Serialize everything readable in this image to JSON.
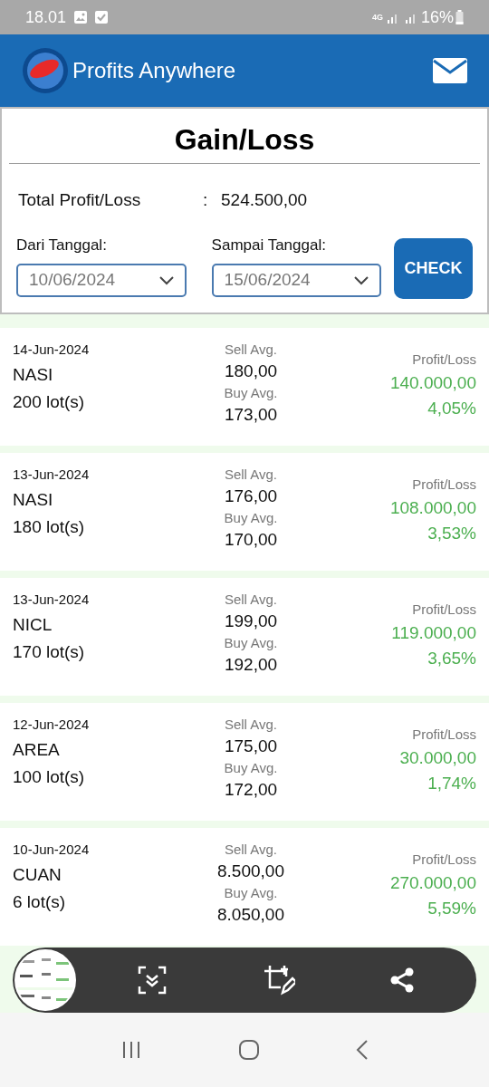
{
  "status_bar": {
    "time": "18.01",
    "network": "4G",
    "battery": "16%"
  },
  "app_bar": {
    "title": "Profits Anywhere"
  },
  "summary": {
    "title": "Gain/Loss",
    "total_label": "Total Profit/Loss",
    "separator": ":",
    "total_value": "524.500,00",
    "from_label": "Dari Tanggal:",
    "from_value": "10/06/2024",
    "to_label": "Sampai Tanggal:",
    "to_value": "15/06/2024",
    "check_button": "CHECK"
  },
  "trades": [
    {
      "date": "14-Jun-2024",
      "code": "NASI",
      "lots": "200 lot(s)",
      "sell_label": "Sell Avg.",
      "sell_avg": "180,00",
      "buy_label": "Buy Avg.",
      "buy_avg": "173,00",
      "pl_label": "Profit/Loss",
      "pl_value": "140.000,00",
      "pl_percent": "4,05%"
    },
    {
      "date": "13-Jun-2024",
      "code": "NASI",
      "lots": "180 lot(s)",
      "sell_label": "Sell Avg.",
      "sell_avg": "176,00",
      "buy_label": "Buy Avg.",
      "buy_avg": "170,00",
      "pl_label": "Profit/Loss",
      "pl_value": "108.000,00",
      "pl_percent": "3,53%"
    },
    {
      "date": "13-Jun-2024",
      "code": "NICL",
      "lots": "170 lot(s)",
      "sell_label": "Sell Avg.",
      "sell_avg": "199,00",
      "buy_label": "Buy Avg.",
      "buy_avg": "192,00",
      "pl_label": "Profit/Loss",
      "pl_value": "119.000,00",
      "pl_percent": "3,65%"
    },
    {
      "date": "12-Jun-2024",
      "code": "AREA",
      "lots": "100 lot(s)",
      "sell_label": "Sell Avg.",
      "sell_avg": "175,00",
      "buy_label": "Buy Avg.",
      "buy_avg": "172,00",
      "pl_label": "Profit/Loss",
      "pl_value": "30.000,00",
      "pl_percent": "1,74%"
    },
    {
      "date": "10-Jun-2024",
      "code": "CUAN",
      "lots": "6 lot(s)",
      "sell_label": "Sell Avg.",
      "sell_avg": "8.500,00",
      "buy_label": "Buy Avg.",
      "buy_avg": "8.050,00",
      "pl_label": "Profit/Loss",
      "pl_value": "270.000,00",
      "pl_percent": "5,59%"
    }
  ]
}
